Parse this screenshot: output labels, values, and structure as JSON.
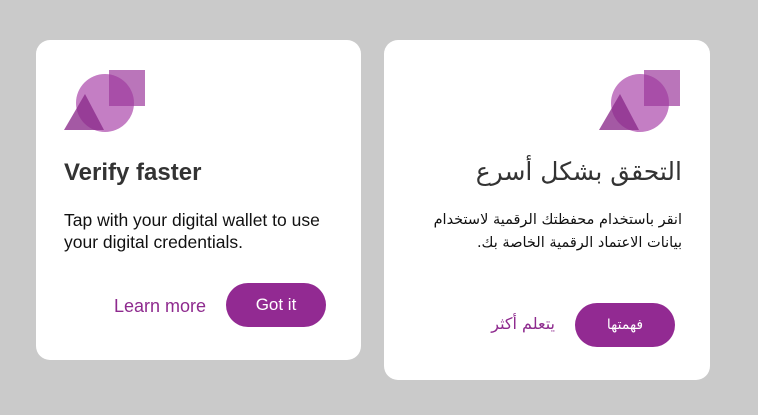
{
  "colors": {
    "background": "#cacaca",
    "card": "#ffffff",
    "accent": "#922a92",
    "logo_circle": "#b053b0",
    "logo_square": "#9c3b9c",
    "logo_triangle": "#8a2a8a"
  },
  "card_ltr": {
    "icon": "verify-logo-icon",
    "title": "Verify faster",
    "body": "Tap with your digital wallet to use your digital credentials.",
    "learn_more_label": "Learn more",
    "got_it_label": "Got it"
  },
  "card_rtl": {
    "icon": "verify-logo-icon",
    "title": "التحقق بشكل أسرع",
    "body": "انقر باستخدام محفظتك الرقمية لاستخدام بيانات الاعتماد الرقمية الخاصة بك.",
    "learn_more_label": "يتعلم أكثر",
    "got_it_label": "فهمتها"
  }
}
